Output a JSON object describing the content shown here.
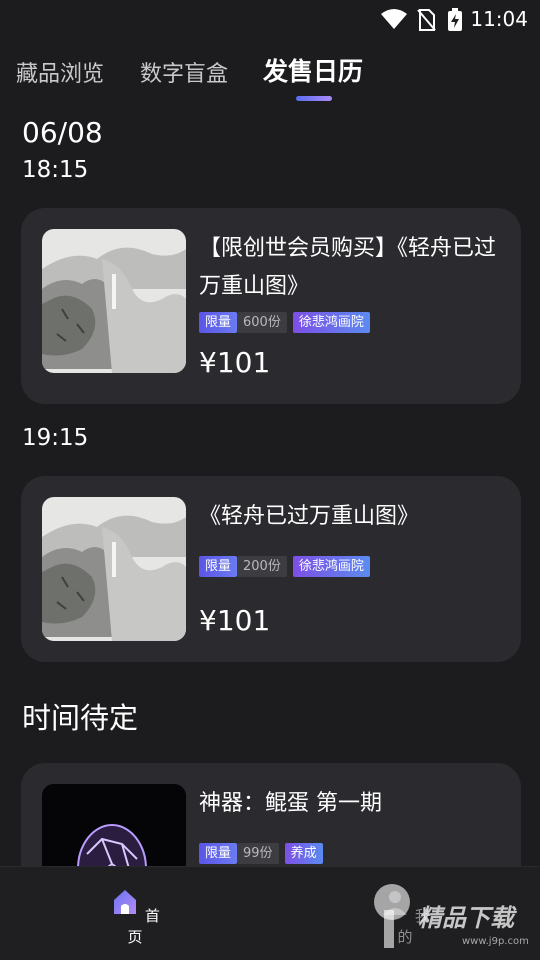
{
  "status_bar": {
    "time": "11:04"
  },
  "tabs": [
    {
      "label": "藏品浏览"
    },
    {
      "label": "数字盲盒"
    },
    {
      "label": "发售日历"
    }
  ],
  "date": "06/08",
  "groups": [
    {
      "time": "18:15",
      "card": {
        "title": "【限创世会员购买】《轻舟已过万重山图》",
        "tag_limit": "限量",
        "tag_count": "600份",
        "tag_brand": "徐悲鸿画院",
        "price": "¥101"
      }
    },
    {
      "time": "19:15",
      "card": {
        "title": "《轻舟已过万重山图》",
        "tag_limit": "限量",
        "tag_count": "200份",
        "tag_brand": "徐悲鸿画院",
        "price": "¥101"
      }
    }
  ],
  "pending": {
    "section_title": "时间待定",
    "card": {
      "title": "神器：鲲蛋 第一期",
      "tag_limit": "限量",
      "tag_count": "99份",
      "tag_brand": "养成"
    }
  },
  "bottom_nav": [
    {
      "label": "首页"
    },
    {
      "label": "我的"
    }
  ],
  "watermark": {
    "text": "精品下载",
    "url": "www.j9p.com"
  }
}
